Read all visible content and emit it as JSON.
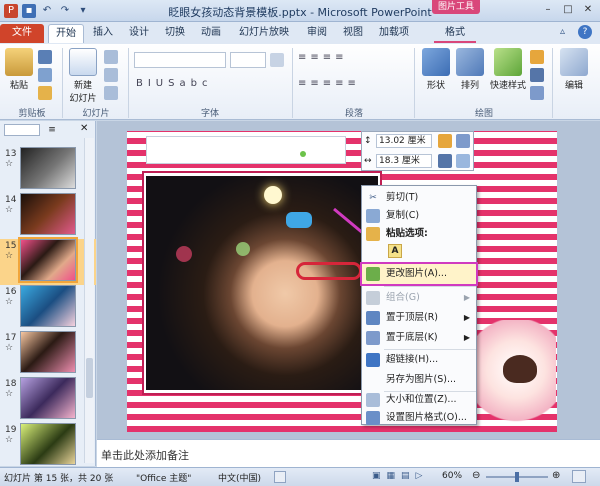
{
  "window": {
    "title": "眨眼女孩动态背景模板.pptx - Microsoft PowerPoint",
    "context_tab": "图片工具"
  },
  "tabs": [
    {
      "label": "文件"
    },
    {
      "label": "开始"
    },
    {
      "label": "插入"
    },
    {
      "label": "设计"
    },
    {
      "label": "切换"
    },
    {
      "label": "动画"
    },
    {
      "label": "幻灯片放映"
    },
    {
      "label": "审阅"
    },
    {
      "label": "视图"
    },
    {
      "label": "加载项"
    },
    {
      "label": "格式"
    }
  ],
  "ribbon": {
    "paste": "粘贴",
    "new_slide_line1": "新建",
    "new_slide_line2": "幻灯片",
    "shape": "形状",
    "arrange": "排列",
    "quick_style": "快速样式",
    "edit": "编辑",
    "groups": {
      "clipboard": "剪贴板",
      "slides": "幻灯片",
      "font": "字体",
      "paragraph": "段落",
      "drawing": "绘图"
    }
  },
  "thumbnails": [
    {
      "num": "13",
      "mark": "☆"
    },
    {
      "num": "14",
      "mark": "☆"
    },
    {
      "num": "15",
      "mark": "☆"
    },
    {
      "num": "16",
      "mark": "☆"
    },
    {
      "num": "17",
      "mark": "☆"
    },
    {
      "num": "18",
      "mark": "☆"
    },
    {
      "num": "19",
      "mark": "☆"
    }
  ],
  "size": {
    "height": "13.02 厘米",
    "width": "18.3 厘米"
  },
  "context_menu": {
    "cut": "剪切(T)",
    "copy": "复制(C)",
    "paste_options": "粘贴选项:",
    "change_picture": "更改图片(A)...",
    "group": "组合(G)",
    "bring_front": "置于顶层(R)",
    "send_back": "置于底层(K)",
    "hyperlink": "超链接(H)...",
    "save_as_picture": "另存为图片(S)...",
    "size_position": "大小和位置(Z)...",
    "format_picture": "设置图片格式(O)..."
  },
  "notes_placeholder": "单击此处添加备注",
  "status": {
    "slide_info": "幻灯片 第 15 张，共 20 张",
    "theme": "\"Office 主题\"",
    "language": "中文(中国)",
    "zoom": "60%"
  },
  "colors": {
    "accent_pink": "#d9477a",
    "stripe": "#e4326b",
    "file_tab": "#d0442a"
  }
}
